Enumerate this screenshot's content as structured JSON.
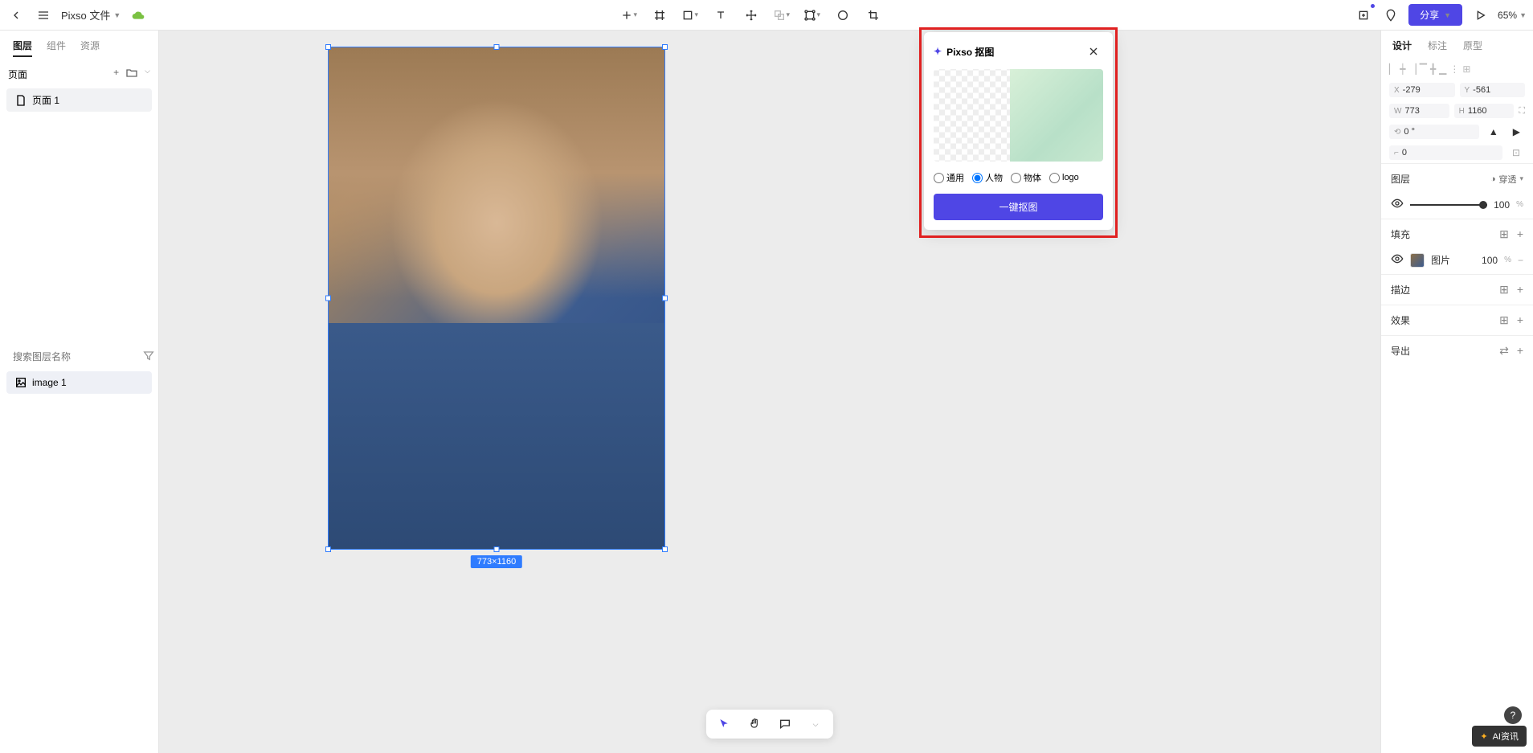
{
  "topbar": {
    "file_title": "Pixso 文件",
    "share_label": "分享",
    "zoom": "65%"
  },
  "left_panel": {
    "tabs": [
      "图层",
      "组件",
      "资源"
    ],
    "pages_label": "页面",
    "pages": [
      "页面 1"
    ],
    "search_placeholder": "搜索图层名称",
    "layers": [
      "image 1"
    ]
  },
  "canvas": {
    "selection_dimensions": "773×1160"
  },
  "popup": {
    "title": "Pixso 抠图",
    "radios": {
      "general": "通用",
      "person": "人物",
      "object": "物体",
      "logo": "logo"
    },
    "button": "一键抠图"
  },
  "right_panel": {
    "tabs": [
      "设计",
      "标注",
      "原型"
    ],
    "position": {
      "x_label": "X",
      "x": "-279",
      "y_label": "Y",
      "y": "-561"
    },
    "size": {
      "w_label": "W",
      "w": "773",
      "h_label": "H",
      "h": "1160"
    },
    "rotation": "0 °",
    "corner": "0",
    "layer_section": "图层",
    "pass_through": "穿透",
    "opacity": "100",
    "opacity_unit": "%",
    "fill_section": "填充",
    "fill_type": "图片",
    "fill_opacity": "100",
    "fill_unit": "%",
    "stroke_section": "描边",
    "effect_section": "效果",
    "export_section": "导出"
  },
  "watermark": "AI资讯"
}
